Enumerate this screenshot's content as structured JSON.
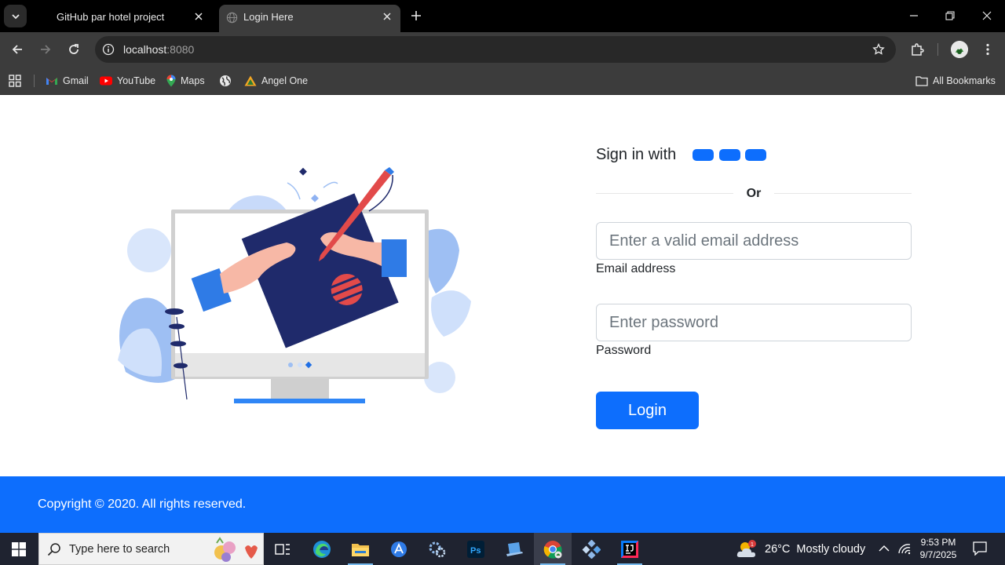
{
  "browser": {
    "tabs": [
      {
        "title": "GitHub par hotel project",
        "active": false
      },
      {
        "title": "Login Here",
        "active": true
      }
    ],
    "url_host": "localhost",
    "url_port": ":8080",
    "bookmarks": [
      {
        "label": "Gmail",
        "icon": "gmail-icon"
      },
      {
        "label": "YouTube",
        "icon": "youtube-icon"
      },
      {
        "label": "Maps",
        "icon": "maps-icon"
      },
      {
        "label": "",
        "icon": "globe-icon"
      },
      {
        "label": "Angel One",
        "icon": "angel-one-icon"
      }
    ],
    "all_bookmarks_label": "All Bookmarks"
  },
  "login": {
    "signin_label": "Sign in with",
    "divider_text": "Or",
    "email": {
      "placeholder": "Enter a valid email address",
      "label": "Email address"
    },
    "password": {
      "placeholder": "Enter password",
      "label": "Password"
    },
    "button_label": "Login"
  },
  "footer": {
    "copyright": "Copyright © 2020. All rights reserved."
  },
  "taskbar": {
    "search_placeholder": "Type here to search",
    "weather": {
      "temperature": "26°C",
      "condition": "Mostly cloudy",
      "badge": "1"
    },
    "time": "9:53 PM",
    "date": "9/7/2025"
  },
  "colors": {
    "primary": "#0d6efd",
    "chrome_dark": "#3c3c3c",
    "taskbar": "#1f2330"
  }
}
